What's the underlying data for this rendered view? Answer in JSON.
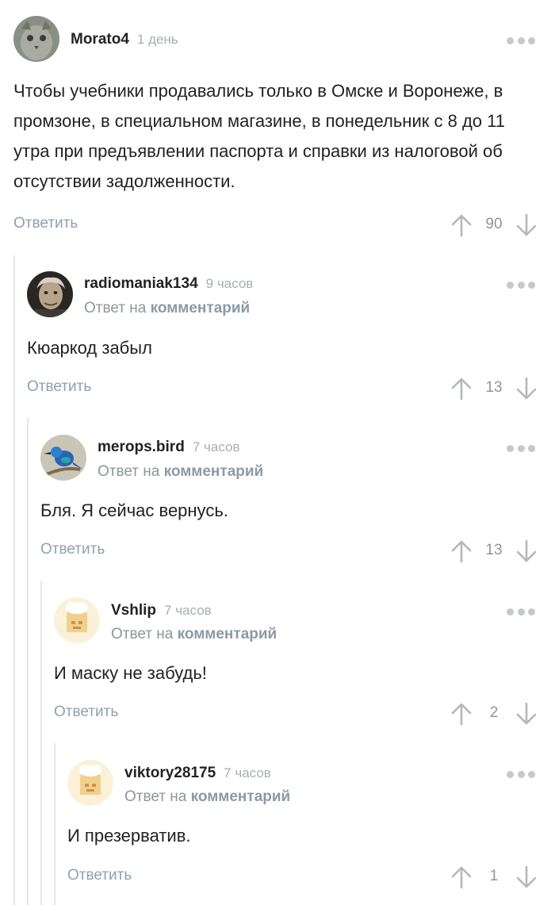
{
  "comments": [
    {
      "username": "Morato4",
      "time": "1 день",
      "text": "Чтобы учебники продавались только в Омске и Воронеже, в промзоне, в специальном магазине, в понедельник с 8 до 11 утра при предъявлении паспорта и справки из налоговой об отсутствии задолженности.",
      "reply_label": "Ответить",
      "score": "90"
    },
    {
      "username": "radiomaniak134",
      "time": "9 часов",
      "reply_prefix": "Ответ на",
      "reply_link": "комментарий",
      "text": "Кюаркод забыл",
      "reply_label": "Ответить",
      "score": "13"
    },
    {
      "username": "merops.bird",
      "time": "7 часов",
      "reply_prefix": "Ответ на",
      "reply_link": "комментарий",
      "text": "Бля. Я сейчас вернусь.",
      "reply_label": "Ответить",
      "score": "13"
    },
    {
      "username": "Vshlip",
      "time": "7 часов",
      "reply_prefix": "Ответ на",
      "reply_link": "комментарий",
      "text": "И маску не забудь!",
      "reply_label": "Ответить",
      "score": "2"
    },
    {
      "username": "viktory28175",
      "time": "7 часов",
      "reply_prefix": "Ответ на",
      "reply_link": "комментарий",
      "text": "И презерватив.",
      "reply_label": "Ответить",
      "score": "1"
    }
  ],
  "icons": {
    "more": "more-options-icon",
    "upvote": "arrow-up-icon",
    "downvote": "arrow-down-icon"
  },
  "colors": {
    "accent_link": "#8da2b0",
    "muted_text": "#8f9599",
    "thread_line": "#e4e6e8"
  }
}
